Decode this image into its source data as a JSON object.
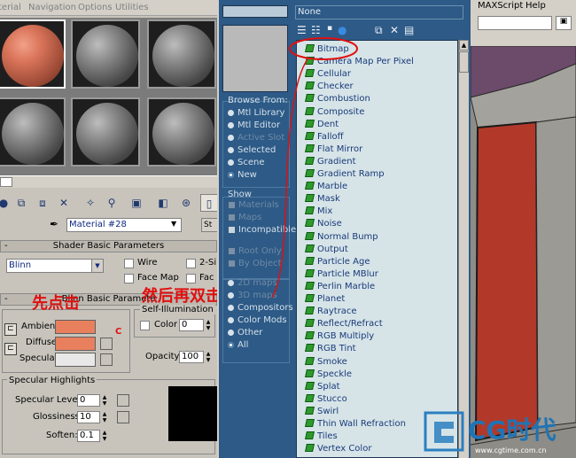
{
  "left_menu": [
    "terial",
    "Navigation",
    "Options",
    "Utilities"
  ],
  "material_name": "Material #28",
  "standard_label": "St",
  "shader_rollout": {
    "sign": "-",
    "title": "Shader Basic Parameters"
  },
  "shader": {
    "type": "Blinn",
    "options": [
      "Wire",
      "2-Si",
      "Face Map",
      "Fac"
    ]
  },
  "blinn_rollout": {
    "sign": "-",
    "title": "Blinn Basic Paramete"
  },
  "self_illumination": {
    "title": "Self-Illumination",
    "color_label": "Color",
    "color_value": "0"
  },
  "blinn": {
    "ambient": "Ambient:",
    "diffuse": "Diffuse:",
    "specular": "Specular:",
    "c_label": "C",
    "opacity_label": "Opacity:",
    "opacity_value": "100"
  },
  "specular_highlights": {
    "title": "Specular Highlights",
    "level_label": "Specular Level:",
    "level_value": "0",
    "gloss_label": "Glossiness:",
    "gloss_value": "10",
    "soften_label": "Soften:",
    "soften_value": "0.1"
  },
  "annotation": {
    "left_text": "先点击",
    "right_text": "然后再双击"
  },
  "browser": {
    "none_label": "None",
    "browse_from_title": "Browse From:",
    "browse_from": [
      {
        "label": "Mtl Library",
        "dim": false,
        "on": false
      },
      {
        "label": "Mtl Editor",
        "dim": false,
        "on": false
      },
      {
        "label": "Active Slot",
        "dim": true,
        "on": false
      },
      {
        "label": "Selected",
        "dim": false,
        "on": false
      },
      {
        "label": "Scene",
        "dim": false,
        "on": false
      },
      {
        "label": "New",
        "dim": false,
        "on": true
      }
    ],
    "show_title": "Show",
    "show": [
      {
        "label": "Materials",
        "dim": true
      },
      {
        "label": "Maps",
        "dim": true
      },
      {
        "label": "Incompatible",
        "dim": false
      }
    ],
    "root_only": "Root Only",
    "by_object": "By Object",
    "categories": [
      {
        "label": "2D maps",
        "dim": true,
        "on": false
      },
      {
        "label": "3D maps",
        "dim": true,
        "on": false
      },
      {
        "label": "Compositors",
        "dim": false,
        "on": false
      },
      {
        "label": "Color Mods",
        "dim": false,
        "on": false
      },
      {
        "label": "Other",
        "dim": false,
        "on": false
      },
      {
        "label": "All",
        "dim": false,
        "on": true
      }
    ],
    "maps": [
      "Bitmap",
      "Camera Map Per Pixel",
      "Cellular",
      "Checker",
      "Combustion",
      "Composite",
      "Dent",
      "Falloff",
      "Flat Mirror",
      "Gradient",
      "Gradient Ramp",
      "Marble",
      "Mask",
      "Mix",
      "Noise",
      "Normal Bump",
      "Output",
      "Particle Age",
      "Particle MBlur",
      "Perlin Marble",
      "Planet",
      "Raytrace",
      "Reflect/Refract",
      "RGB Multiply",
      "RGB Tint",
      "Smoke",
      "Speckle",
      "Splat",
      "Stucco",
      "Swirl",
      "Thin Wall Refraction",
      "Tiles",
      "Vertex Color"
    ]
  },
  "viewport_menu": [
    "MAXScript",
    "Help"
  ],
  "watermark": {
    "text": "CG时代",
    "url": "www.cgtime.com.cn"
  },
  "colors": {
    "browser_bg": "#2d5a86",
    "list_bg": "#d6e4e8",
    "swatch": "#e8805e",
    "annotation": "#e01010",
    "map_icon": "#2e9a2e"
  }
}
